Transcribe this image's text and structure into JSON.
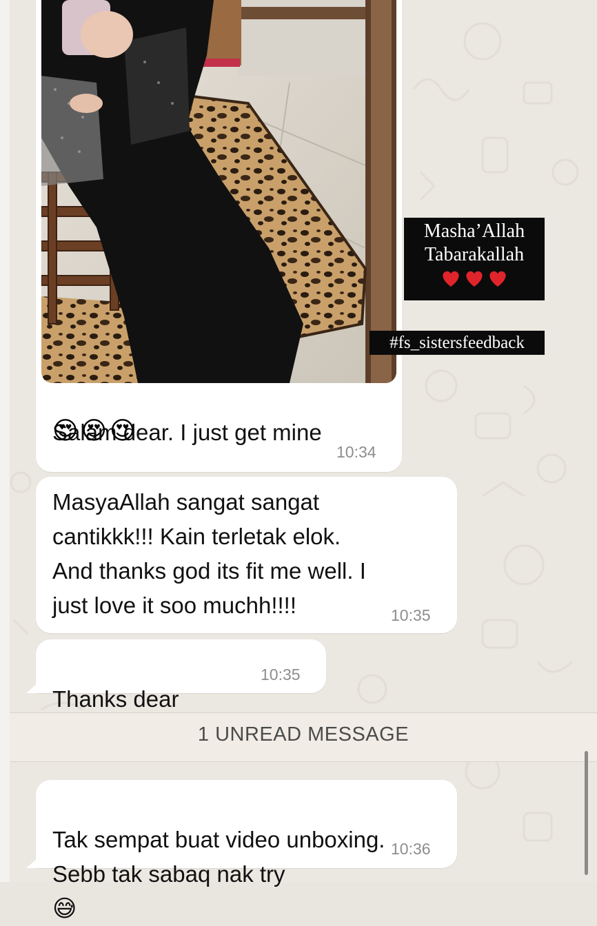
{
  "image_card": {
    "overlay_title_line1": "Masha’Allah",
    "overlay_title_line2": "Tabarakallah",
    "overlay_hearts": "❤️❤️❤️",
    "hashtag": "#fs_sistersfeedback"
  },
  "messages": [
    {
      "text_line1": "Salam dear. I just get mine",
      "emojis": "😍😍😍",
      "time": "10:34"
    },
    {
      "text": "MasyaAllah sangat sangat\ncantikkk!!! Kain terletak elok.\nAnd thanks god its fit me well. I\njust love it soo muchh!!!!",
      "time": "10:35"
    },
    {
      "text": "Thanks dear",
      "emoji": "🫶",
      "time": "10:35"
    },
    {
      "text": "Tak sempat buat video unboxing.\nSebb tak sabaq nak try",
      "emoji": "😅",
      "time": "10:36"
    }
  ],
  "unread_divider": {
    "label": "1 UNREAD MESSAGE"
  },
  "colors": {
    "chat_background": "#ebe7e1",
    "bubble": "#ffffff",
    "timestamp": "#8d8d8d",
    "overlay_box": "#0b0b0b",
    "heart": "#e0242b"
  }
}
